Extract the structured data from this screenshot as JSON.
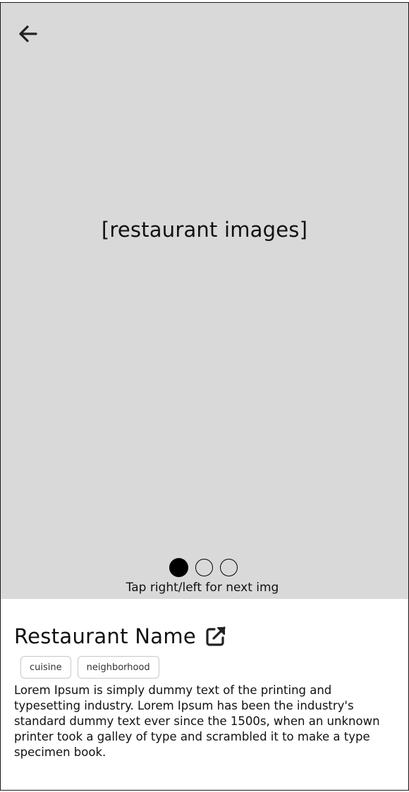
{
  "hero": {
    "placeholder": "[restaurant images]",
    "hint": "Tap right/left for next img",
    "carousel": {
      "total": 3,
      "active_index": 0
    },
    "background_color": "#d9d9d9"
  },
  "icons": {
    "back": "arrow-left-icon",
    "external_link": "external-link-icon"
  },
  "restaurant": {
    "name": "Restaurant Name",
    "tags": [
      "cuisine",
      "neighborhood"
    ],
    "description": "Lorem Ipsum is simply dummy text of the printing and typesetting industry. Lorem Ipsum has been the industry's standard dummy text ever since the 1500s, when an unknown printer took a galley of type and scrambled it to make a type specimen book."
  }
}
